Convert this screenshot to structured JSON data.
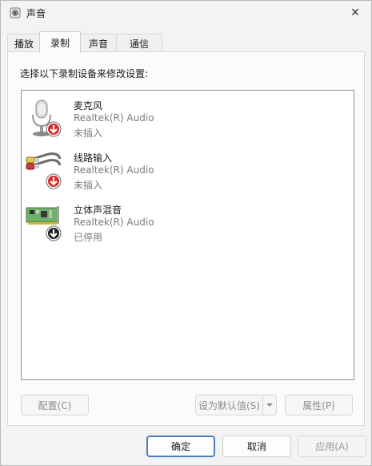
{
  "window": {
    "title": "声音",
    "close_glyph": "✕"
  },
  "tabs": [
    {
      "label": "播放",
      "active": false
    },
    {
      "label": "录制",
      "active": true
    },
    {
      "label": "声音",
      "active": false
    },
    {
      "label": "通信",
      "active": false
    }
  ],
  "instructions": "选择以下录制设备来修改设置:",
  "devices": [
    {
      "name": "麦克风",
      "driver": "Realtek(R) Audio",
      "status": "未插入",
      "icon": "microphone-icon",
      "badge": "red-down-arrow"
    },
    {
      "name": "线路输入",
      "driver": "Realtek(R) Audio",
      "status": "未插入",
      "icon": "line-in-cable-icon",
      "badge": "red-down-arrow"
    },
    {
      "name": "立体声混音",
      "driver": "Realtek(R) Audio",
      "status": "已停用",
      "icon": "sound-card-icon",
      "badge": "black-down-arrow"
    }
  ],
  "panel_buttons": {
    "configure": "配置(C)",
    "set_default": "设为默认值(S)",
    "properties": "属性(P)"
  },
  "footer": {
    "ok": "确定",
    "cancel": "取消",
    "apply": "应用(A)"
  },
  "colors": {
    "accent": "#4a7fbf",
    "badge_red": "#d62a2a",
    "list_border": "#8f8f8f"
  }
}
